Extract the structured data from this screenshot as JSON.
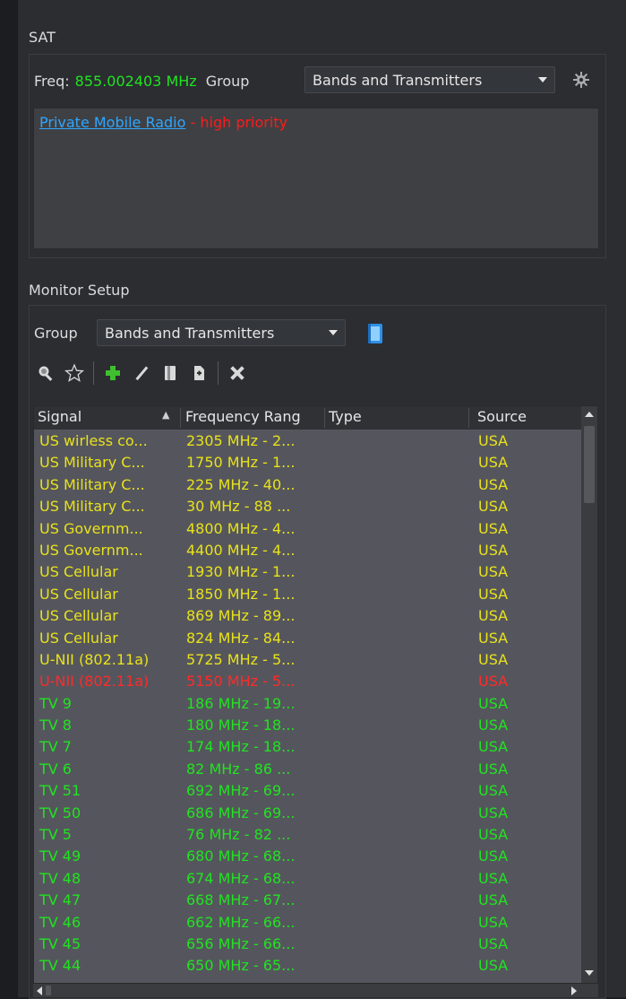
{
  "sat": {
    "title": "SAT",
    "freq_label": "Freq:",
    "freq_value": "855.002403 MHz",
    "group_label": "Group",
    "group_value": "Bands and Transmitters",
    "info_link": "Private Mobile Radio",
    "info_priority": " - high priority"
  },
  "monitor": {
    "title": "Monitor Setup",
    "group_label": "Group",
    "group_value": "Bands and Transmitters"
  },
  "table": {
    "columns": [
      "Signal",
      "Frequency Rang",
      "Type",
      "Source"
    ],
    "rows": [
      {
        "signal": "US wirless co...",
        "freq": "2305 MHz - 2...",
        "type": "",
        "source": "USA",
        "color": "#e8e21b"
      },
      {
        "signal": "US Military C...",
        "freq": "1750 MHz - 1...",
        "type": "",
        "source": "USA",
        "color": "#e8e21b"
      },
      {
        "signal": "US Military C...",
        "freq": "225 MHz - 40...",
        "type": "",
        "source": "USA",
        "color": "#e8e21b"
      },
      {
        "signal": "US Military C...",
        "freq": "30 MHz - 88 ...",
        "type": "",
        "source": "USA",
        "color": "#e8e21b"
      },
      {
        "signal": "US Governm...",
        "freq": "4800 MHz - 4...",
        "type": "",
        "source": "USA",
        "color": "#e8e21b"
      },
      {
        "signal": "US Governm...",
        "freq": "4400 MHz - 4...",
        "type": "",
        "source": "USA",
        "color": "#e8e21b"
      },
      {
        "signal": "US Cellular",
        "freq": "1930 MHz - 1...",
        "type": "",
        "source": "USA",
        "color": "#e8e21b"
      },
      {
        "signal": "US Cellular",
        "freq": "1850 MHz - 1...",
        "type": "",
        "source": "USA",
        "color": "#e8e21b"
      },
      {
        "signal": "US Cellular",
        "freq": "869 MHz - 89...",
        "type": "",
        "source": "USA",
        "color": "#e8e21b"
      },
      {
        "signal": "US Cellular",
        "freq": "824 MHz - 84...",
        "type": "",
        "source": "USA",
        "color": "#e8e21b"
      },
      {
        "signal": "U-NII (802.11a)",
        "freq": "5725 MHz - 5...",
        "type": "",
        "source": "USA",
        "color": "#e8e21b"
      },
      {
        "signal": "U-NII (802.11a)",
        "freq": "5150 MHz - 5...",
        "type": "",
        "source": "USA",
        "color": "#ff2a2a"
      },
      {
        "signal": "TV 9",
        "freq": "186 MHz - 19...",
        "type": "",
        "source": "USA",
        "color": "#21e321"
      },
      {
        "signal": "TV 8",
        "freq": "180 MHz - 18...",
        "type": "",
        "source": "USA",
        "color": "#21e321"
      },
      {
        "signal": "TV 7",
        "freq": "174 MHz - 18...",
        "type": "",
        "source": "USA",
        "color": "#21e321"
      },
      {
        "signal": "TV 6",
        "freq": "82 MHz - 86 ...",
        "type": "",
        "source": "USA",
        "color": "#21e321"
      },
      {
        "signal": "TV 51",
        "freq": "692 MHz - 69...",
        "type": "",
        "source": "USA",
        "color": "#21e321"
      },
      {
        "signal": "TV 50",
        "freq": "686 MHz - 69...",
        "type": "",
        "source": "USA",
        "color": "#21e321"
      },
      {
        "signal": "TV 5",
        "freq": "76 MHz - 82 ...",
        "type": "",
        "source": "USA",
        "color": "#21e321"
      },
      {
        "signal": "TV 49",
        "freq": "680 MHz - 68...",
        "type": "",
        "source": "USA",
        "color": "#21e321"
      },
      {
        "signal": "TV 48",
        "freq": "674 MHz - 68...",
        "type": "",
        "source": "USA",
        "color": "#21e321"
      },
      {
        "signal": "TV 47",
        "freq": "668 MHz - 67...",
        "type": "",
        "source": "USA",
        "color": "#21e321"
      },
      {
        "signal": "TV 46",
        "freq": "662 MHz - 66...",
        "type": "",
        "source": "USA",
        "color": "#21e321"
      },
      {
        "signal": "TV 45",
        "freq": "656 MHz - 66...",
        "type": "",
        "source": "USA",
        "color": "#21e321"
      },
      {
        "signal": "TV 44",
        "freq": "650 MHz - 65...",
        "type": "",
        "source": "USA",
        "color": "#21e321"
      }
    ]
  },
  "colors": {
    "green": "#21e321",
    "yellow": "#e8e21b",
    "red": "#ff2a2a",
    "link": "#2fa6ff"
  }
}
